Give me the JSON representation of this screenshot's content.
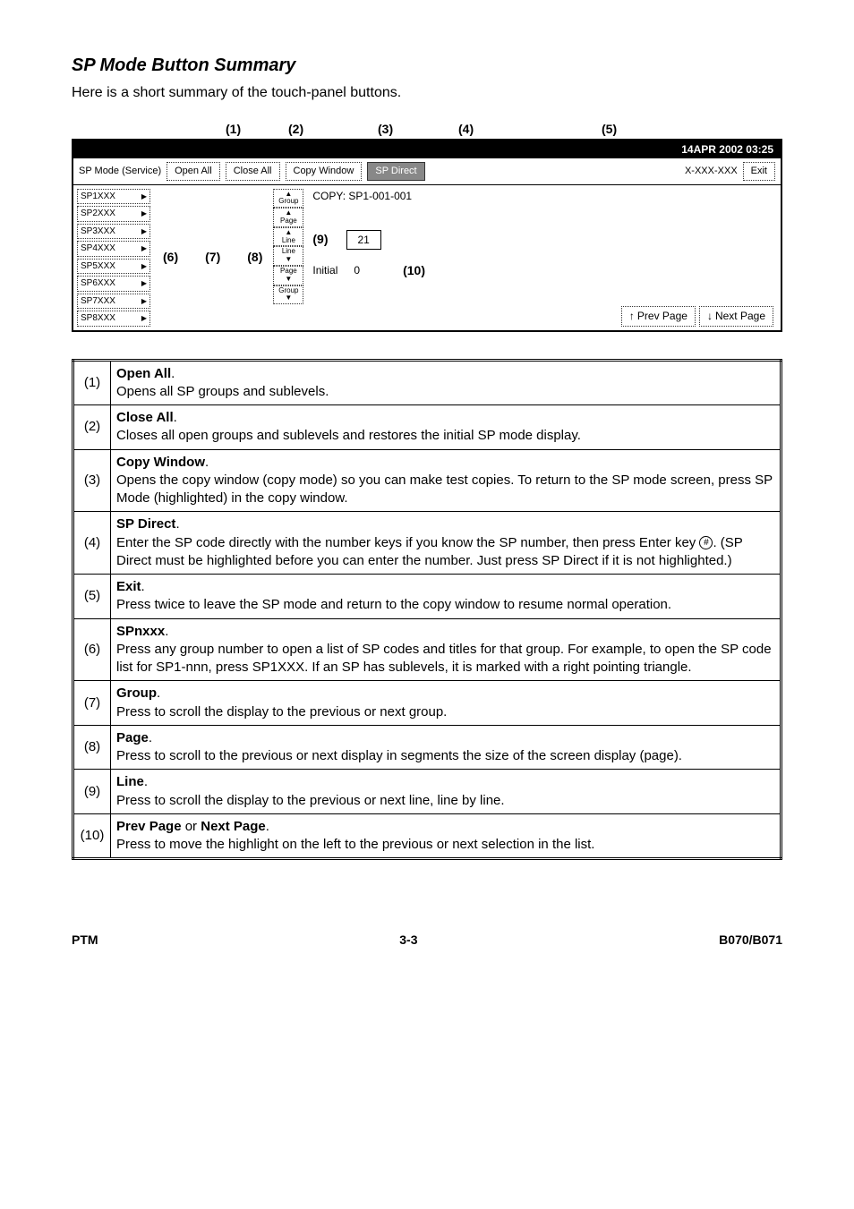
{
  "heading": "SP Mode Button Summary",
  "intro": "Here is a short summary of the touch-panel buttons.",
  "callouts": {
    "c1": "(1)",
    "c2": "(2)",
    "c3": "(3)",
    "c4": "(4)",
    "c5": "(5)",
    "c6": "(6)",
    "c7": "(7)",
    "c8": "(8)",
    "c9": "(9)",
    "c10": "(10)"
  },
  "diagram": {
    "timestamp": "14APR 2002 03:25",
    "mode_label": "SP Mode (Service)",
    "open_all": "Open All",
    "close_all": "Close All",
    "copy_window": "Copy Window",
    "sp_direct": "SP Direct",
    "xxx": "X-XXX-XXX",
    "exit": "Exit",
    "copy_title": "COPY: SP1-001-001",
    "initial_label": "Initial",
    "initial_val": "0",
    "value_box": "21",
    "prev": "Prev Page",
    "next": "Next Page",
    "nav": {
      "group": "Group",
      "page": "Page",
      "line": "Line"
    },
    "sp_items": [
      "SP1XXX",
      "SP2XXX",
      "SP3XXX",
      "SP4XXX",
      "SP5XXX",
      "SP6XXX",
      "SP7XXX",
      "SP8XXX"
    ]
  },
  "rows": [
    {
      "n": "(1)",
      "title": "Open All",
      "body": "Opens all SP groups and sublevels."
    },
    {
      "n": "(2)",
      "title": "Close All",
      "body": "Closes all open groups and sublevels and restores the initial SP mode display."
    },
    {
      "n": "(3)",
      "title": "Copy Window",
      "body": "Opens the copy window (copy mode) so you can make test copies. To return to the SP mode screen, press SP Mode (highlighted) in the copy window."
    },
    {
      "n": "(4)",
      "title": "SP Direct",
      "body_pre": "Enter the SP code directly with the number keys if you know the SP number, then press Enter key ",
      "key": "#",
      "body_post": ". (SP Direct must be highlighted before you can enter the number. Just press SP Direct if it is not highlighted.)"
    },
    {
      "n": "(5)",
      "title": "Exit",
      "body": "Press twice to leave the SP mode and return to the copy window to resume normal operation."
    },
    {
      "n": "(6)",
      "title": "SPnxxx",
      "body": "Press any group number to open a list of SP codes and titles for that group. For example, to open the SP code list for SP1-nnn, press SP1XXX. If an SP has sublevels, it is marked with a right pointing triangle."
    },
    {
      "n": "(7)",
      "title": "Group",
      "body": "Press to scroll the display to the previous or next group."
    },
    {
      "n": "(8)",
      "title": "Page",
      "body": "Press to scroll to the previous or next display in segments the size of the screen display (page)."
    },
    {
      "n": "(9)",
      "title": "Line",
      "body": "Press to scroll the display to the previous or next line, line by line."
    },
    {
      "n": "(10)",
      "title": "Prev Page",
      "title_join": " or ",
      "title2": "Next Page",
      "body": "Press to move the highlight on the left to the previous or next selection in the list."
    }
  ],
  "footer": {
    "left": "PTM",
    "center": "3-3",
    "right": "B070/B071"
  }
}
